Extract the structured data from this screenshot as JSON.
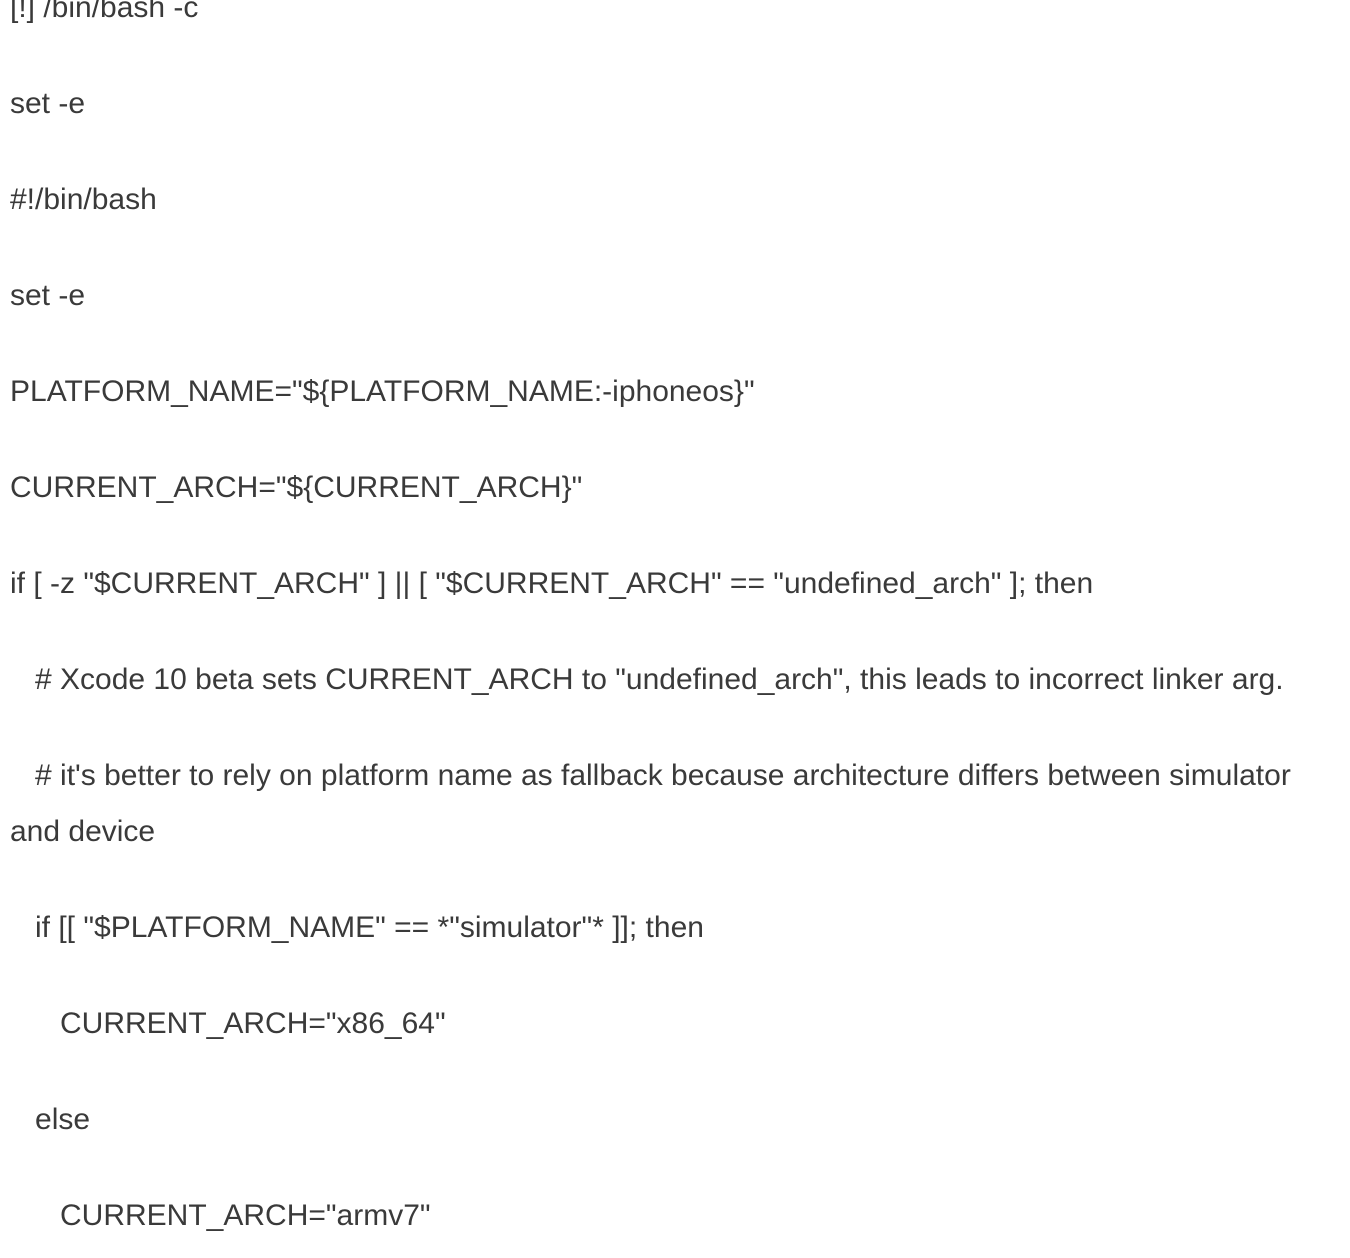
{
  "document": {
    "lines": [
      "[!] /bin/bash -c",
      "set -e",
      "#!/bin/bash",
      "set -e",
      "PLATFORM_NAME=\"${PLATFORM_NAME:-iphoneos}\"",
      "CURRENT_ARCH=\"${CURRENT_ARCH}\"",
      "if [ -z \"$CURRENT_ARCH\" ] || [ \"$CURRENT_ARCH\" == \"undefined_arch\" ]; then",
      "   # Xcode 10 beta sets CURRENT_ARCH to \"undefined_arch\", this leads to incorrect linker arg.",
      "   # it's better to rely on platform name as fallback because architecture differs between simulator and device",
      "   if [[ \"$PLATFORM_NAME\" == *\"simulator\"* ]]; then",
      "      CURRENT_ARCH=\"x86_64\"",
      "   else",
      "      CURRENT_ARCH=\"armv7\""
    ]
  }
}
